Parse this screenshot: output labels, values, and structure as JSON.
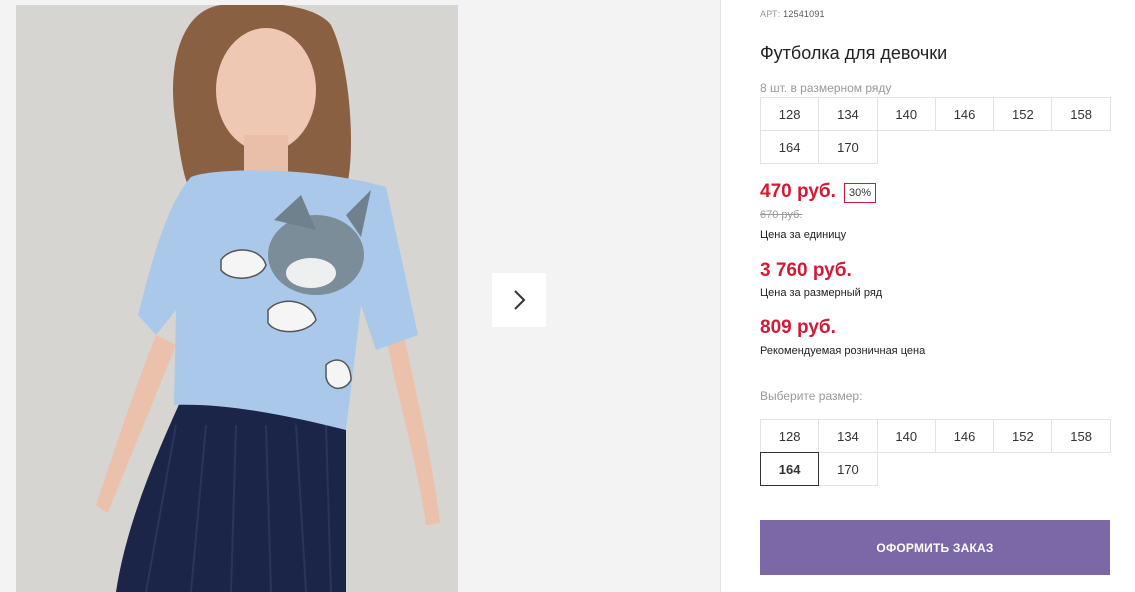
{
  "product": {
    "sku_label": "АРТ:",
    "sku": "12541091",
    "title": "Футболка для девочки",
    "pack_note": "8 шт. в размерном ряду",
    "pack_sizes": [
      [
        "128",
        "134",
        "140",
        "146",
        "152",
        "158"
      ],
      [
        "164",
        "170"
      ]
    ],
    "price": "470 руб.",
    "discount": "30%",
    "old_price": "670 руб.",
    "unit_price_label": "Цена за единицу",
    "pack_price": "3 760 руб.",
    "pack_price_label": "Цена за размерный ряд",
    "retail_price": "809 руб.",
    "retail_price_label": "Рекомендуемая розничная цена"
  },
  "size_select": {
    "label": "Выберите размер:",
    "sizes": [
      [
        "128",
        "134",
        "140",
        "146",
        "152",
        "158"
      ],
      [
        "164",
        "170"
      ]
    ],
    "selected": "164"
  },
  "order_button": {
    "label": "ОФОРМИТЬ ЗАКАЗ"
  },
  "colors": {
    "accent": "#d41935",
    "button": "#7b68a6"
  },
  "icons": {
    "next": "chevron-right-icon"
  }
}
